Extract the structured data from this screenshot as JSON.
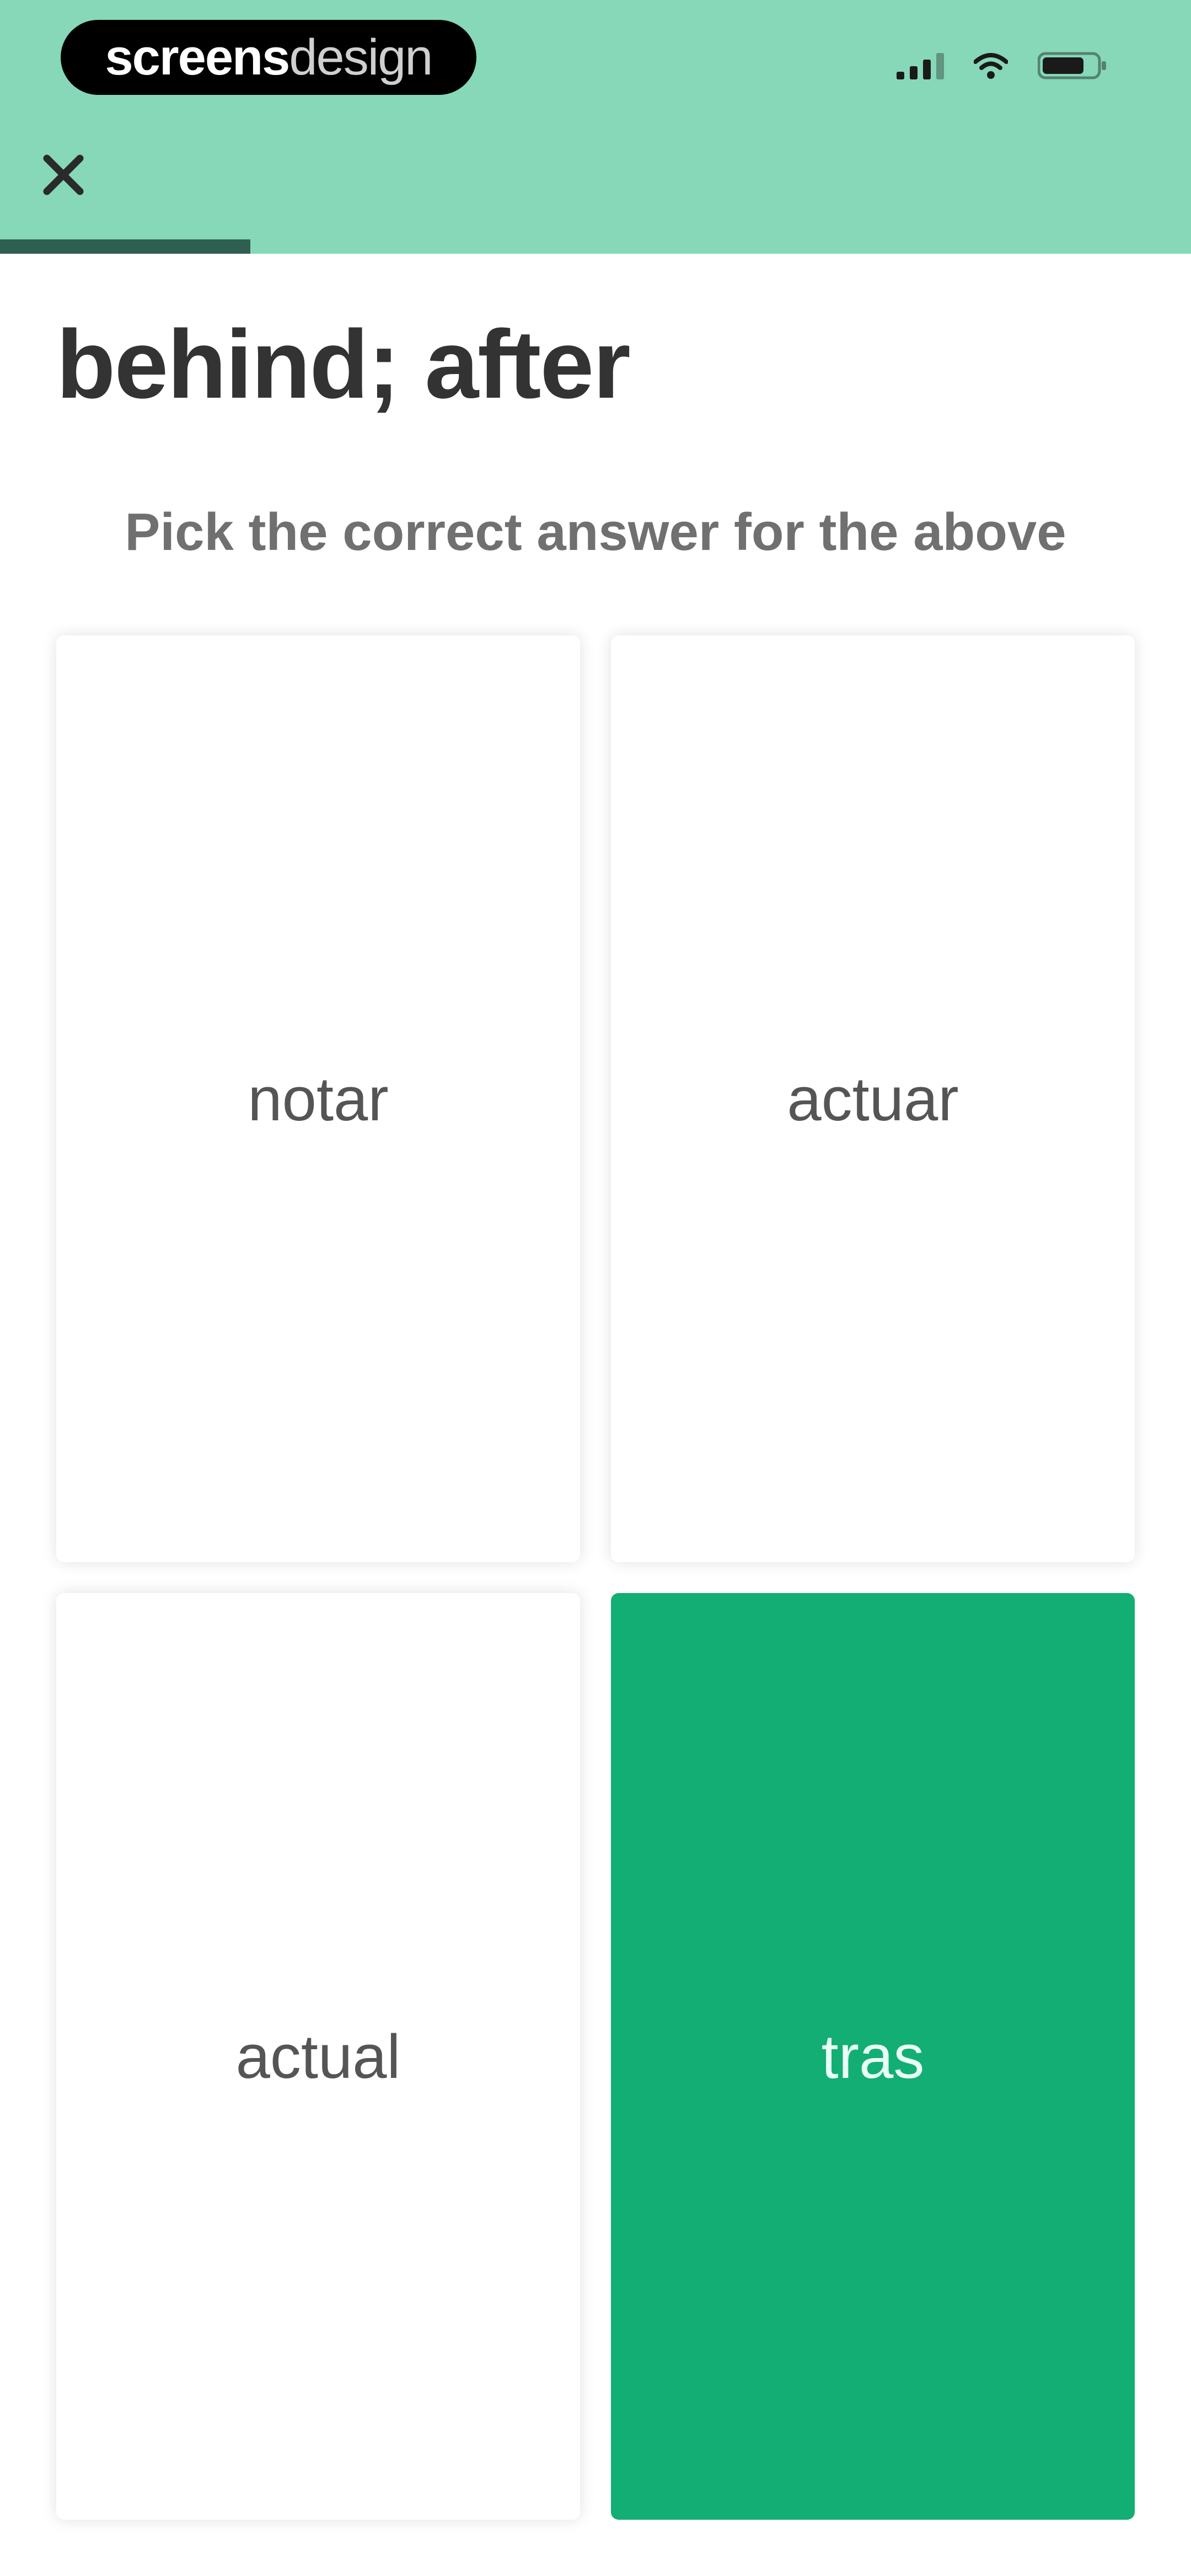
{
  "brand": {
    "part1": "screens",
    "part2": "design"
  },
  "quiz": {
    "progress_fraction": 0.21,
    "prompt": "behind; after",
    "instruction": "Pick the correct answer for the above",
    "options": [
      {
        "label": "notar",
        "selected": false
      },
      {
        "label": "actuar",
        "selected": false
      },
      {
        "label": "actual",
        "selected": false
      },
      {
        "label": "tras",
        "selected": true
      }
    ]
  },
  "colors": {
    "header": "#86d8b8",
    "progress": "#2f5f50",
    "selected": "#12ae74"
  },
  "icons": {
    "close": "close-icon",
    "signal": "signal-icon",
    "wifi": "wifi-icon",
    "battery": "battery-icon"
  }
}
